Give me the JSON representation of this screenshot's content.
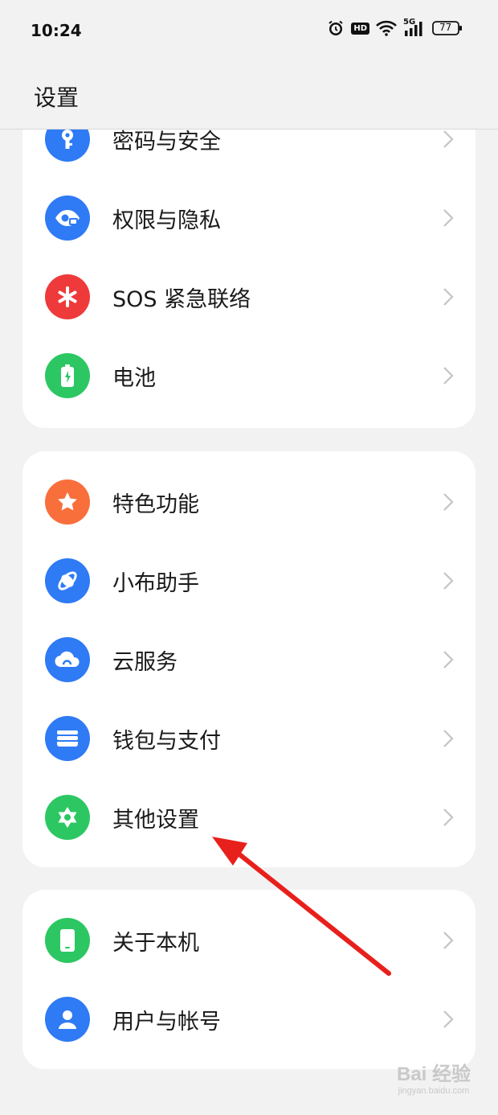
{
  "status_bar": {
    "time": "10:24",
    "network_type": "5G",
    "hd_label": "HD",
    "battery_level": "77",
    "icons": [
      "alarm-icon",
      "hd-icon",
      "wifi-icon",
      "signal-5g-icon",
      "battery-icon"
    ]
  },
  "header": {
    "title": "设置"
  },
  "groups": [
    {
      "items": [
        {
          "label": "密码与安全",
          "icon": "key-icon",
          "color": "#2f7af5"
        },
        {
          "label": "权限与隐私",
          "icon": "privacy-eye-icon",
          "color": "#2f7af5"
        },
        {
          "label": "SOS 紧急联络",
          "icon": "sos-asterisk-icon",
          "color": "#ee3a3a"
        },
        {
          "label": "电池",
          "icon": "battery-icon",
          "color": "#2cc763"
        }
      ]
    },
    {
      "items": [
        {
          "label": "特色功能",
          "icon": "star-icon",
          "color": "#f86f3c"
        },
        {
          "label": "小布助手",
          "icon": "assistant-icon",
          "color": "#2f7af5"
        },
        {
          "label": "云服务",
          "icon": "cloud-icon",
          "color": "#2f7af5"
        },
        {
          "label": "钱包与支付",
          "icon": "wallet-icon",
          "color": "#2f7af5"
        },
        {
          "label": "其他设置",
          "icon": "gear-star-icon",
          "color": "#2cc763"
        }
      ]
    },
    {
      "items": [
        {
          "label": "关于本机",
          "icon": "phone-icon",
          "color": "#2cc763"
        },
        {
          "label": "用户与帐号",
          "icon": "user-icon",
          "color": "#2f7af5"
        }
      ]
    }
  ],
  "annotation": {
    "arrow_color": "#e8201c",
    "points_to": "其他设置"
  },
  "watermark": {
    "text": "Bai 经验",
    "sub": "jingyan.baidu.com"
  }
}
